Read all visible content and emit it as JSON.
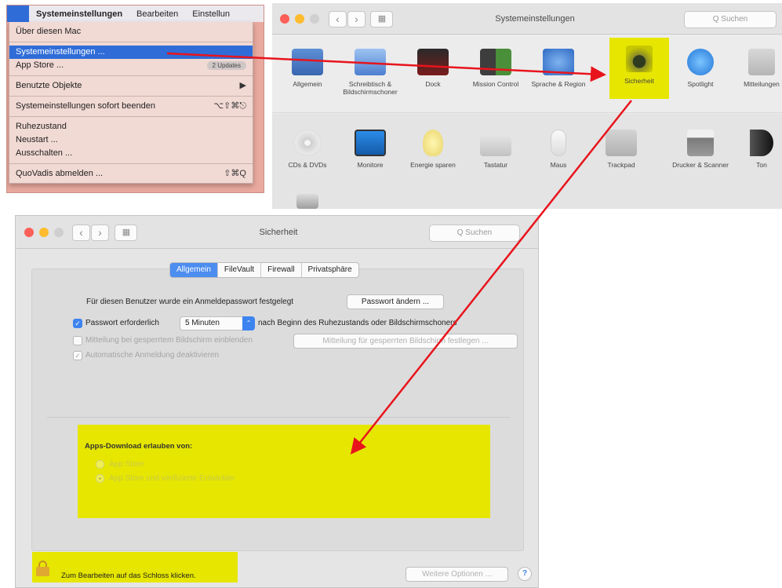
{
  "menubar": {
    "apple_glyph": "",
    "items": [
      "Systemeinstellungen",
      "Bearbeiten",
      "Einstellun"
    ]
  },
  "apple_menu": {
    "about": "Über diesen Mac",
    "sysprefs": "Systemeinstellungen ...",
    "app_store": "App Store ...",
    "app_store_badge": "2 Updates",
    "recent_items": "Benutzte Objekte",
    "recent_items_arrow": "▶",
    "force_quit": "Systemeinstellungen sofort beenden",
    "force_quit_shortcut": "⌥⇧⌘⎋",
    "sleep": "Ruhezustand",
    "restart": "Neustart ...",
    "shutdown": "Ausschalten ...",
    "logout": "QuoVadis abmelden ...",
    "logout_shortcut": "⇧⌘Q"
  },
  "sysprefs_window": {
    "title": "Systemeinstellungen",
    "search_placeholder": "Q Suchen",
    "nav_back": "‹",
    "nav_forward": "›",
    "grid_glyph": "▦",
    "row1": [
      "Allgemein",
      "Schreibtisch & Bildschirmschoner",
      "Dock",
      "Mission Control",
      "Sprache & Region",
      "Sicherheit",
      "Spotlight",
      "Mitteilungen"
    ],
    "row2": [
      "CDs & DVDs",
      "Monitore",
      "Energie sparen",
      "Tastatur",
      "Maus",
      "Trackpad",
      "Drucker & Scanner",
      "Ton"
    ]
  },
  "security_window": {
    "title": "Sicherheit",
    "search_placeholder": "Q Suchen",
    "nav_back": "‹",
    "nav_forward": "›",
    "grid_glyph": "▦",
    "tabs": [
      "Allgemein",
      "FileVault",
      "Firewall",
      "Privatsphäre"
    ],
    "password_text": "Für diesen Benutzer wurde ein Anmeldepasswort festgelegt",
    "change_password_button": "Passwort ändern ...",
    "require_password_label": "Passwort erforderlich",
    "require_password_value": "5 Minuten",
    "require_password_suffix": "nach Beginn des Ruhezustands oder Bildschirmschoners",
    "show_message_label": "Mitteilung bei gesperrtem Bildschirm einblenden",
    "set_message_button": "Mitteilung für gesperrten Bildschirm festlegen ...",
    "auto_login_label": "Automatische Anmeldung deaktivieren",
    "check_glyph": "✓",
    "popup_arrow": "⌃",
    "apps_download_heading": "Apps-Download erlauben von:",
    "option_app_store": "App Store",
    "option_verified": "App Store und verifizierte Entwickler",
    "lock_text": "Zum Bearbeiten auf das Schloss klicken.",
    "advanced_button": "Weitere Optionen ...",
    "help_glyph": "?"
  },
  "colors": {
    "highlight_yellow": "#e6e600",
    "arrow_red": "#e8141c",
    "selection_blue": "#2f6cd8"
  }
}
